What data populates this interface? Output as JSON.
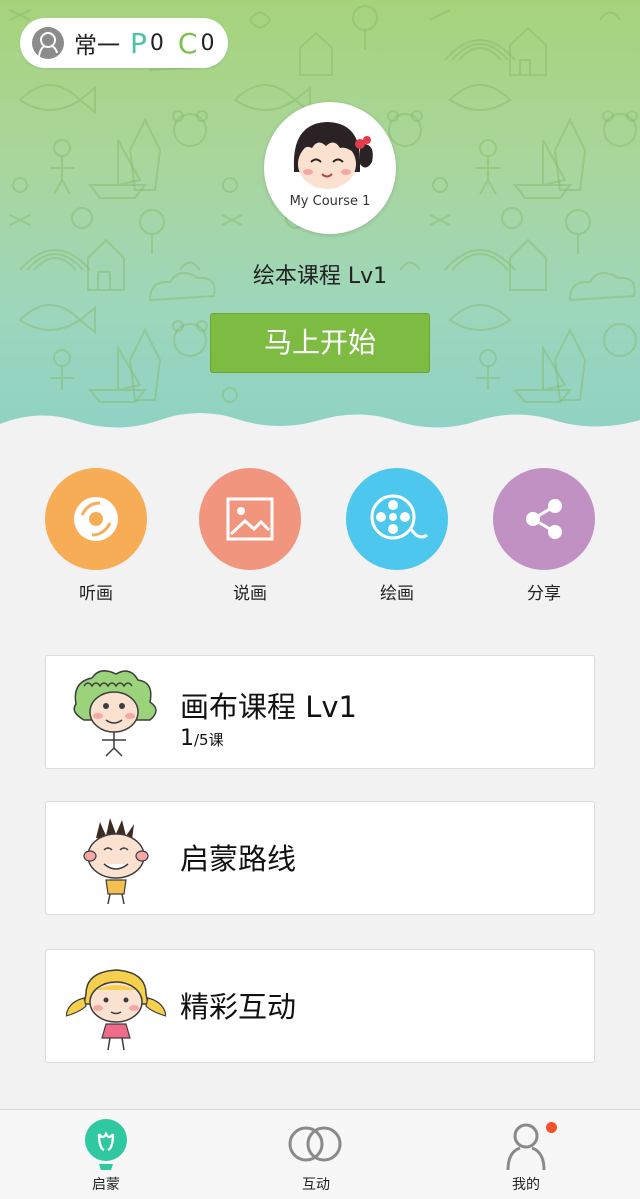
{
  "user": {
    "name": "常一",
    "p_letter": "P",
    "p_value": "0",
    "c_letter": "C",
    "c_value": "0"
  },
  "course": {
    "avatar_label": "My Course 1",
    "title": "绘本课程 Lv1",
    "start_label": "马上开始"
  },
  "features": [
    {
      "label": "听画",
      "icon": "disc-icon",
      "color": "#f6ad55"
    },
    {
      "label": "说画",
      "icon": "picture-icon",
      "color": "#f2957e"
    },
    {
      "label": "绘画",
      "icon": "film-reel-icon",
      "color": "#4ec7ee"
    },
    {
      "label": "分享",
      "icon": "share-icon",
      "color": "#c191c4"
    }
  ],
  "cards": [
    {
      "title": "画布课程 Lv1",
      "progress_current": "1",
      "progress_total": "/5课"
    },
    {
      "title": "启蒙路线"
    },
    {
      "title": "精彩互动"
    }
  ],
  "nav": [
    {
      "label": "启蒙",
      "icon": "bulb-icon",
      "active": true,
      "color": "#2fc8a0"
    },
    {
      "label": "互动",
      "icon": "rings-icon"
    },
    {
      "label": "我的",
      "icon": "person-icon",
      "badge": true
    }
  ]
}
